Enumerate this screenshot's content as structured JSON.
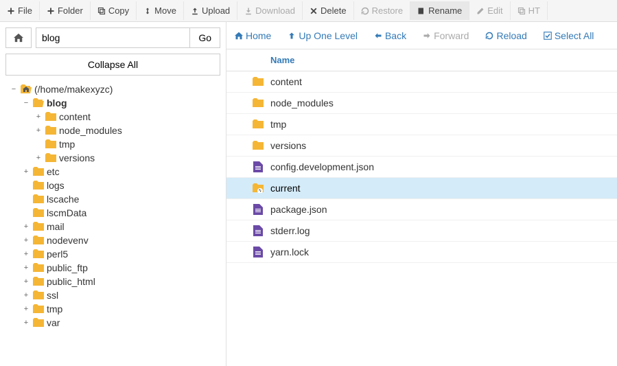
{
  "toolbar": [
    {
      "label": "File",
      "icon": "plus",
      "state": "on",
      "name": "new-file-button"
    },
    {
      "label": "Folder",
      "icon": "plus",
      "state": "on",
      "name": "new-folder-button"
    },
    {
      "label": "Copy",
      "icon": "copy",
      "state": "on",
      "name": "copy-button"
    },
    {
      "label": "Move",
      "icon": "move",
      "state": "on",
      "name": "move-button"
    },
    {
      "label": "Upload",
      "icon": "upload",
      "state": "on",
      "name": "upload-button"
    },
    {
      "label": "Download",
      "icon": "download",
      "state": "off",
      "name": "download-button"
    },
    {
      "label": "Delete",
      "icon": "delete",
      "state": "on",
      "name": "delete-button"
    },
    {
      "label": "Restore",
      "icon": "restore",
      "state": "off",
      "name": "restore-button"
    },
    {
      "label": "Rename",
      "icon": "rename",
      "state": "rename",
      "name": "rename-button"
    },
    {
      "label": "Edit",
      "icon": "edit",
      "state": "off",
      "name": "edit-button"
    },
    {
      "label": "HT",
      "icon": "ht",
      "state": "off",
      "name": "htaccess-button"
    }
  ],
  "address": {
    "value": "blog",
    "go_label": "Go"
  },
  "collapse_label": "Collapse All",
  "tree": [
    {
      "depth": 0,
      "toggle": "−",
      "icon": "folder-open-home",
      "label": "(/home/makexyzc)",
      "bold": false
    },
    {
      "depth": 1,
      "toggle": "−",
      "icon": "folder-open",
      "label": "blog",
      "bold": true
    },
    {
      "depth": 2,
      "toggle": "+",
      "icon": "folder",
      "label": "content",
      "bold": false
    },
    {
      "depth": 2,
      "toggle": "+",
      "icon": "folder",
      "label": "node_modules",
      "bold": false
    },
    {
      "depth": 2,
      "toggle": "",
      "icon": "folder",
      "label": "tmp",
      "bold": false
    },
    {
      "depth": 2,
      "toggle": "+",
      "icon": "folder",
      "label": "versions",
      "bold": false
    },
    {
      "depth": 1,
      "toggle": "+",
      "icon": "folder",
      "label": "etc",
      "bold": false
    },
    {
      "depth": 1,
      "toggle": "",
      "icon": "folder",
      "label": "logs",
      "bold": false
    },
    {
      "depth": 1,
      "toggle": "",
      "icon": "folder",
      "label": "lscache",
      "bold": false
    },
    {
      "depth": 1,
      "toggle": "",
      "icon": "folder",
      "label": "lscmData",
      "bold": false
    },
    {
      "depth": 1,
      "toggle": "+",
      "icon": "folder",
      "label": "mail",
      "bold": false
    },
    {
      "depth": 1,
      "toggle": "+",
      "icon": "folder",
      "label": "nodevenv",
      "bold": false
    },
    {
      "depth": 1,
      "toggle": "+",
      "icon": "folder",
      "label": "perl5",
      "bold": false
    },
    {
      "depth": 1,
      "toggle": "+",
      "icon": "folder",
      "label": "public_ftp",
      "bold": false
    },
    {
      "depth": 1,
      "toggle": "+",
      "icon": "folder",
      "label": "public_html",
      "bold": false
    },
    {
      "depth": 1,
      "toggle": "+",
      "icon": "folder",
      "label": "ssl",
      "bold": false
    },
    {
      "depth": 1,
      "toggle": "+",
      "icon": "folder",
      "label": "tmp",
      "bold": false
    },
    {
      "depth": 1,
      "toggle": "+",
      "icon": "folder",
      "label": "var",
      "bold": false
    }
  ],
  "nav": {
    "home": "Home",
    "up": "Up One Level",
    "back": "Back",
    "forward": "Forward",
    "reload": "Reload",
    "select_all": "Select All"
  },
  "list_header": {
    "name": "Name"
  },
  "files": [
    {
      "name": "content",
      "icon": "folder",
      "selected": false,
      "editing": false
    },
    {
      "name": "node_modules",
      "icon": "folder",
      "selected": false,
      "editing": false
    },
    {
      "name": "tmp",
      "icon": "folder",
      "selected": false,
      "editing": false
    },
    {
      "name": "versions",
      "icon": "folder",
      "selected": false,
      "editing": false
    },
    {
      "name": "config.development.json",
      "icon": "file",
      "selected": false,
      "editing": false
    },
    {
      "name": "current",
      "icon": "folder-link",
      "selected": true,
      "editing": true
    },
    {
      "name": "package.json",
      "icon": "file",
      "selected": false,
      "editing": false
    },
    {
      "name": "stderr.log",
      "icon": "file",
      "selected": false,
      "editing": false
    },
    {
      "name": "yarn.lock",
      "icon": "file",
      "selected": false,
      "editing": false
    }
  ]
}
